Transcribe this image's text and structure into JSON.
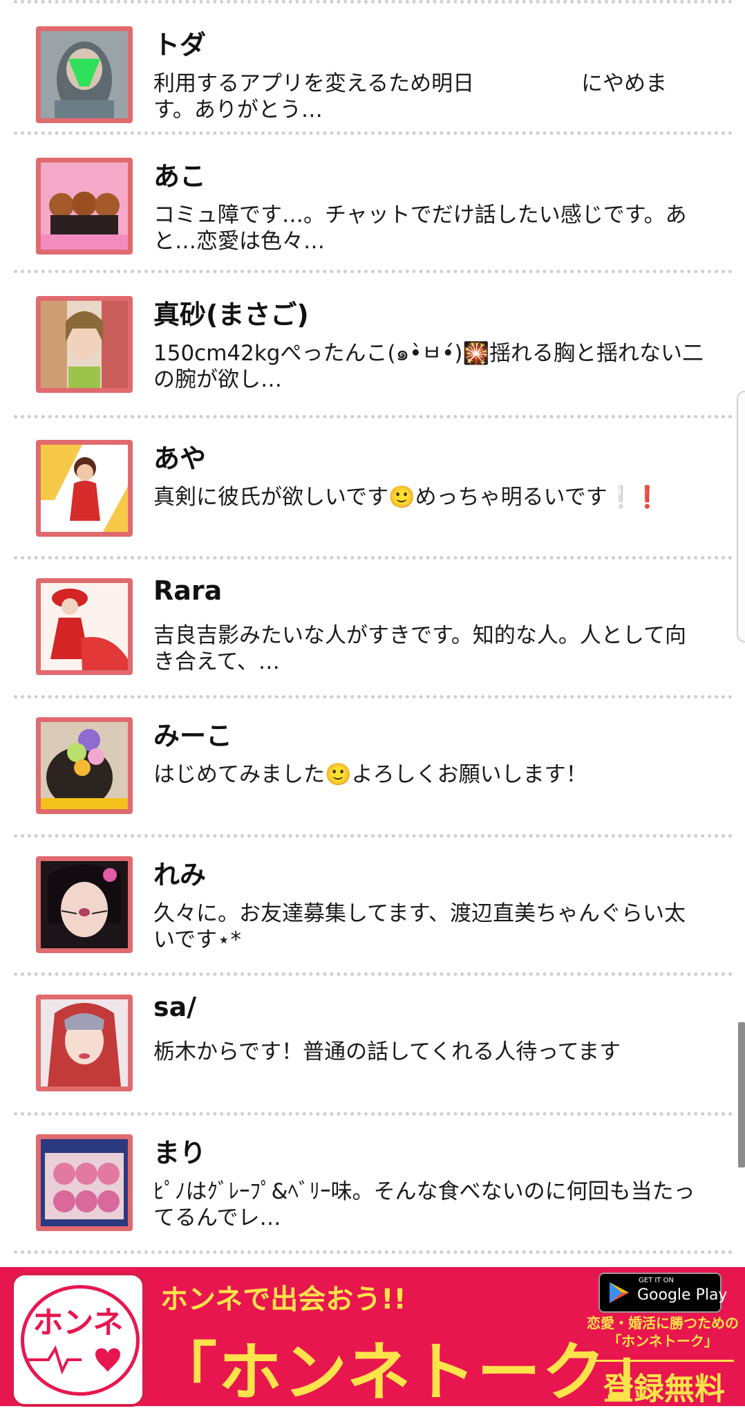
{
  "users": [
    {
      "name": "トダ",
      "message": "利用するアプリを変えるため明日　　　　　にやめます。ありがとう…",
      "avatar": "avatar-green-mask"
    },
    {
      "name": "あこ",
      "message": "コミュ障です…。チャットでだけ話したい感じです。あと…恋愛は色々…",
      "avatar": "avatar-puppies"
    },
    {
      "name": "真砂(まさご)",
      "message": "150cm42kgぺったんこ(๑•̀ㅂ•́)🎇揺れる胸と揺れない二の腕が欲し…",
      "avatar": "avatar-selfies"
    },
    {
      "name": "あや",
      "message": "真剣に彼氏が欲しいです🙂めっちゃ明るいです❕❗",
      "avatar": "avatar-doll"
    },
    {
      "name": "Rara",
      "message": "吉良吉影みたいな人がすきです。知的な人。人として向き合えて、…",
      "avatar": "avatar-red-dress"
    },
    {
      "name": "みーこ",
      "message": "はじめてみました🙂よろしくお願いします！",
      "avatar": "avatar-flowers"
    },
    {
      "name": "れみ",
      "message": "久々に。お友達募集してます、渡辺直美ちゃんぐらい太いです⋆*",
      "avatar": "avatar-cat-face"
    },
    {
      "name": "sa/",
      "message": "栃木からです！普通の話してくれる人待ってます",
      "avatar": "avatar-red-hair"
    },
    {
      "name": "まり",
      "message": "ﾋﾟﾉはｸﾞﾚｰﾌﾟ&ﾍﾞﾘｰ味。そんな食べないのに何回も当たってるんでレ…",
      "avatar": "avatar-cupcakes"
    }
  ],
  "banner": {
    "icon_title": "ホンネ",
    "tagline": "ホンネで出会おう!!",
    "headline": "「ホンネトーク」",
    "side_copy_line1": "恋愛・婚活に勝つための",
    "side_copy_line2": "「ホンネトーク」",
    "free_text": "登録無料",
    "store_small": "GET IT ON",
    "store_big": "Google Play"
  },
  "colors": {
    "avatar_border": "#e06a6e",
    "banner_bg": "#e8164f",
    "banner_text": "#ffe34a",
    "separator": "#cfcfcf"
  }
}
